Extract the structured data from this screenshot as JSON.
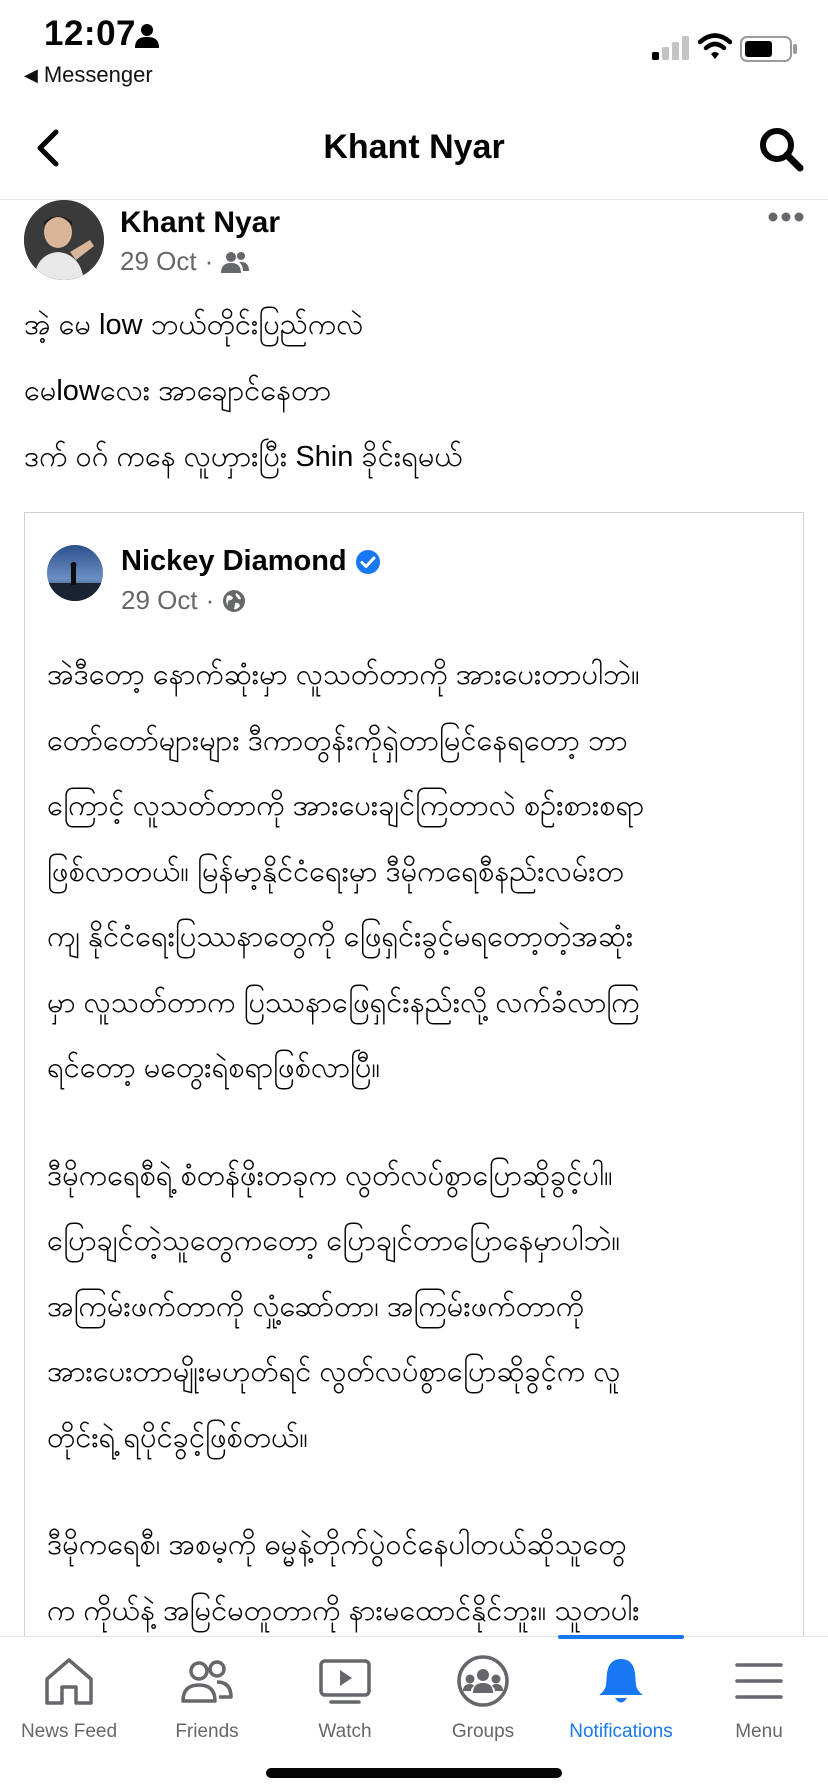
{
  "status_bar": {
    "time": "12:07",
    "back_app": "Messenger"
  },
  "header": {
    "title": "Khant Nyar"
  },
  "post": {
    "author": "Khant Nyar",
    "date": "29 Oct",
    "meta_separator": "·",
    "audience_icon": "friends-icon",
    "lines": [
      "အဲ့ မေ low ဘယ်တိုင်းပြည်ကလဲ",
      "မေlowလေး အာချောင်နေတာ",
      "ဒက် ဝဂ် ကနေ လူဟှားပြီး Shin ခိုင်းရမယ်"
    ]
  },
  "shared_post": {
    "author": "Nickey Diamond",
    "verified_icon": "verified-badge-icon",
    "date": "29 Oct",
    "meta_separator": "·",
    "audience_icon": "globe-icon",
    "paragraphs": [
      [
        "အဲဒီတော့ နောက်ဆုံးမှာ လူသတ်တာကို အားပေးတာပါဘဲ။",
        "တော်တော်များများ ဒီကာတွန်းကိုရှဲတာမြင်နေရတော့ ဘာ",
        "ကြောင့် လူသတ်တာကို အားပေးချင်ကြတာလဲ စဉ်းစားစရာ",
        "ဖြစ်လာတယ်။ မြန်မာ့နိုင်ငံရေးမှာ ဒီမိုကရေစီနည်းလမ်းတ",
        "ကျ နိုင်ငံရေးပြဿနာတွေကို ဖြေရှင်းခွင့်မရတော့တဲ့အဆုံး",
        "မှာ လူသတ်တာက ပြဿနာဖြေရှင်းနည်းလို့ လက်ခံလာကြ",
        "ရင်တော့ မတွေးရဲစရာဖြစ်လာပြီ။"
      ],
      [
        "ဒီမိုကရေစီရဲ့ စံတန်ဖိုးတခုက လွတ်လပ်စွာပြောဆိုခွင့်ပါ။",
        "ပြောချင်တဲ့သူတွေကတော့ ပြောချင်တာပြောနေမှာပါဘဲ။",
        "အကြမ်းဖက်တာကို လှုံ့ဆော်တာ၊ အကြမ်းဖက်တာကို",
        "အားပေးတာမျိုးမဟုတ်ရင် လွတ်လပ်စွာပြောဆိုခွင့်က လူ",
        "တိုင်းရဲ့ ရပိုင်ခွင့်ဖြစ်တယ်။"
      ],
      [
        "ဒီမိုကရေစီ၊ အစမ့ကို ဓမ္မနဲ့တိုက်ပွဲဝင်နေပါတယ်ဆိုသူတွေ",
        "က ကိုယ်နဲ့ အမြင်မတူတာကို နားမထောင်နိုင်ဘူး။ သူတပါး"
      ]
    ]
  },
  "bottom_nav": {
    "items": [
      {
        "label": "News Feed",
        "icon": "home-icon",
        "active": false
      },
      {
        "label": "Friends",
        "icon": "friends-icon",
        "active": false
      },
      {
        "label": "Watch",
        "icon": "watch-icon",
        "active": false
      },
      {
        "label": "Groups",
        "icon": "groups-icon",
        "active": false
      },
      {
        "label": "Notifications",
        "icon": "bell-icon",
        "active": true
      },
      {
        "label": "Menu",
        "icon": "menu-icon",
        "active": false
      }
    ]
  },
  "colors": {
    "accent": "#1877f2",
    "text": "#050505",
    "secondary_text": "#65676b",
    "inactive_icon": "#65676b"
  }
}
